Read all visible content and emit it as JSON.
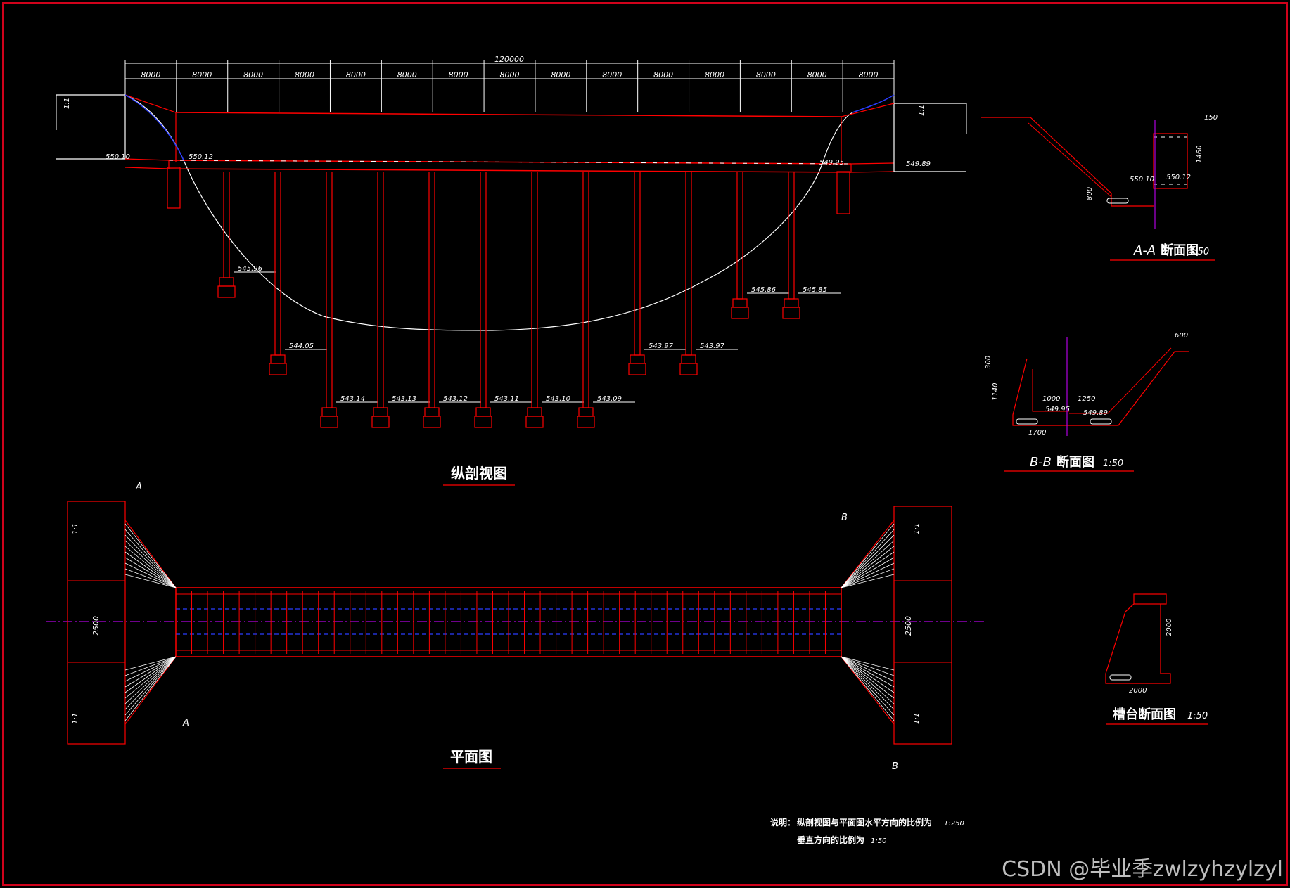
{
  "drawing": {
    "frame_color": "#d0021b",
    "structure_color": "#ff0000",
    "ground_color": "#ffffff",
    "centerline_color": "#b000e0",
    "hidden_color": "#2a3cff"
  },
  "profile": {
    "title": "纵剖视图",
    "total_length": "120000",
    "spans": [
      "8000",
      "8000",
      "8000",
      "8000",
      "8000",
      "8000",
      "8000",
      "8000",
      "8000",
      "8000",
      "8000",
      "8000",
      "8000",
      "8000",
      "8000"
    ],
    "slope_left": "1:1",
    "slope_right": "1:1",
    "inlet_elevs": [
      "550.10",
      "550.12"
    ],
    "outlet_elevs": [
      "549.95",
      "549.89"
    ],
    "pier_base_elevs": [
      {
        "label": "545.96"
      },
      {
        "label": "544.05"
      },
      {
        "label": "543.14"
      },
      {
        "label": "543.13"
      },
      {
        "label": "543.12"
      },
      {
        "label": "543.11"
      },
      {
        "label": "543.10"
      },
      {
        "label": "543.09"
      },
      {
        "label": "543.97"
      },
      {
        "label": "543.97"
      },
      {
        "label": "545.86"
      },
      {
        "label": "545.85"
      }
    ]
  },
  "plan": {
    "title": "平面图",
    "width_left": "2500",
    "width_right": "2500",
    "slope_marks": [
      "1:1",
      "1:1",
      "1:1",
      "1:1"
    ],
    "section_marks": [
      "A",
      "A",
      "B",
      "B"
    ]
  },
  "section_aa": {
    "title": "A-A",
    "title_suffix": "断面图",
    "scale": "1:50",
    "dims": [
      "150",
      "1460",
      "800"
    ],
    "elevs": [
      "550.10",
      "550.12"
    ]
  },
  "section_bb": {
    "title": "B-B",
    "title_suffix": "断面图",
    "scale": "1:50",
    "dims": [
      "600",
      "300",
      "1140",
      "1000",
      "1250",
      "1700"
    ],
    "elevs": [
      "549.95",
      "549.89"
    ]
  },
  "section_abut": {
    "title": "槽台断面图",
    "scale": "1:50",
    "dims": [
      "2000",
      "2000"
    ]
  },
  "notes": {
    "label": "说明：",
    "line1": "纵剖视图与平面图水平方向的比例为",
    "scale1": "1:250",
    "line2": "垂直方向的比例为",
    "scale2": "1:50"
  },
  "watermark": "CSDN @毕业季zwlzyhzylzyl"
}
